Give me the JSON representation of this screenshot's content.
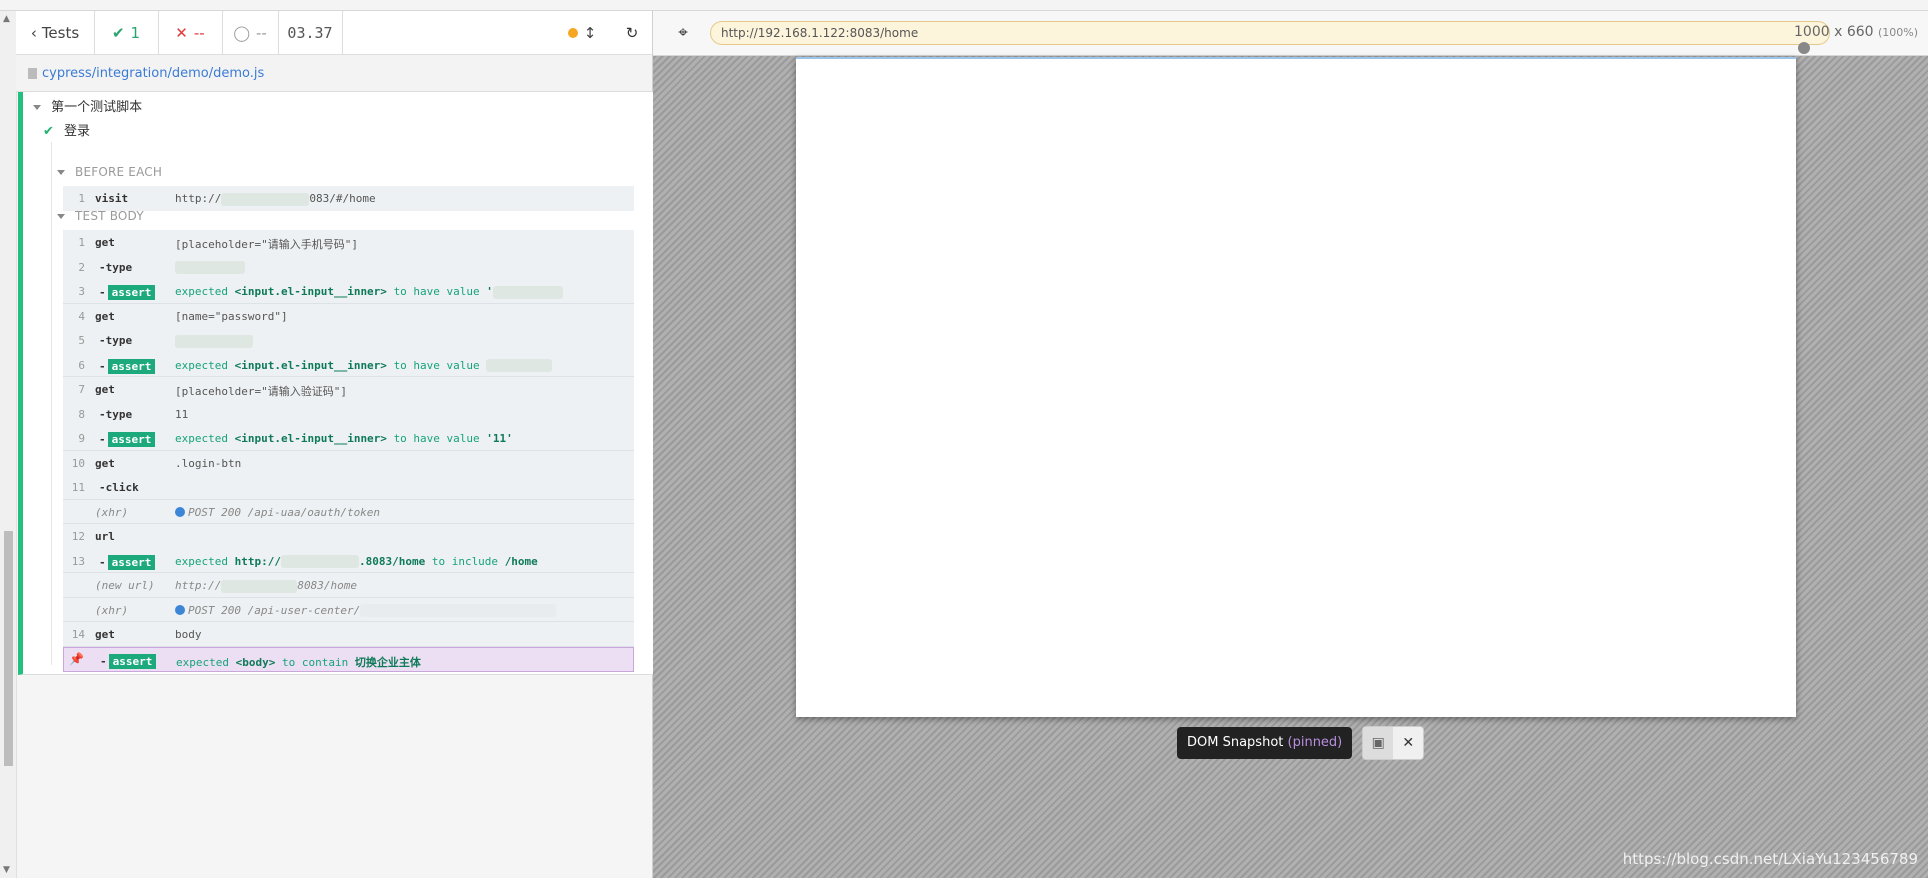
{
  "header": {
    "tests_label": "Tests",
    "passed": "1",
    "failed": "--",
    "pending": "--",
    "duration": "03.37"
  },
  "spec": {
    "path": "cypress/integration/demo/demo.js"
  },
  "suite": {
    "title": "第一个测试脚本",
    "test_title": "登录"
  },
  "hooks": {
    "before_each": "BEFORE EACH",
    "test_body": "TEST BODY"
  },
  "before_each_cmds": [
    {
      "n": "1",
      "name": "visit",
      "msg_pre": "http://",
      "msg_post": "083/#/home"
    }
  ],
  "body_cmds": {
    "c1": {
      "n": "1",
      "name": "get",
      "msg": "[placeholder=\"请输入手机号码\"]"
    },
    "c2": {
      "n": "2",
      "name": "-type"
    },
    "c3": {
      "n": "3",
      "name": "-",
      "badge": "assert",
      "exp": "expected",
      "el": "<input.el-input__inner>",
      "mid": "to have value",
      "val": "'"
    },
    "c4": {
      "n": "4",
      "name": "get",
      "msg": "[name=\"password\"]"
    },
    "c5": {
      "n": "5",
      "name": "-type"
    },
    "c6": {
      "n": "6",
      "name": "-",
      "badge": "assert",
      "exp": "expected",
      "el": "<input.el-input__inner>",
      "mid": "to have value"
    },
    "c7": {
      "n": "7",
      "name": "get",
      "msg": "[placeholder=\"请输入验证码\"]"
    },
    "c8": {
      "n": "8",
      "name": "-type",
      "msg": "11"
    },
    "c9": {
      "n": "9",
      "name": "-",
      "badge": "assert",
      "exp": "expected",
      "el": "<input.el-input__inner>",
      "mid": "to have value",
      "val": "'11'"
    },
    "c10": {
      "n": "10",
      "name": "get",
      "msg": ".login-btn"
    },
    "c11": {
      "n": "11",
      "name": "-click"
    },
    "xhr1": {
      "name": "(xhr)",
      "msg": "POST 200 /api-uaa/oauth/token"
    },
    "c12": {
      "n": "12",
      "name": "url"
    },
    "c13": {
      "n": "13",
      "name": "-",
      "badge": "assert",
      "exp": "expected",
      "el_pre": "http://",
      "el_post": ".8083/home",
      "mid": "to include",
      "val": "/home"
    },
    "newurl": {
      "name": "(new url)",
      "msg_pre": "http://",
      "msg_post": "8083/home"
    },
    "xhr2": {
      "name": "(xhr)",
      "msg": "POST 200 /api-user-center/"
    },
    "c14": {
      "n": "14",
      "name": "get",
      "msg": "body"
    },
    "c15": {
      "name": "-",
      "badge": "assert",
      "exp": "expected",
      "el": "<body>",
      "mid": "to contain",
      "val": "切换企业主体"
    }
  },
  "aut": {
    "url": "http://192.168.1.122:8083/home",
    "viewport": "1000 x 660",
    "viewport_pct": "(100%)",
    "snapshot_label": "DOM Snapshot",
    "snapshot_pinned": "(pinned)"
  },
  "watermark": "https://blog.csdn.net/LXiaYu123456789",
  "colors": {
    "pass": "#20c07e",
    "fail": "#e03a3a",
    "running": "#f5a623",
    "pinned": "#ecdff3"
  }
}
